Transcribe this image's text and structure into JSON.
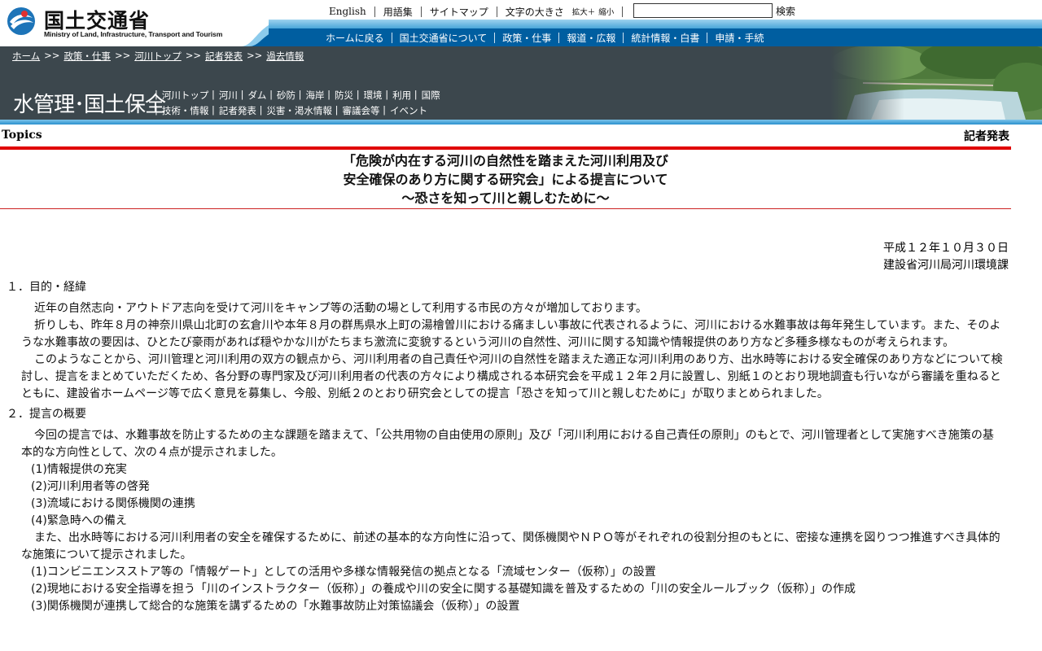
{
  "header": {
    "logo_jp": "国土交通省",
    "logo_en": "Ministry of Land, Infrastructure, Transport and Tourism",
    "util_links": [
      "English",
      "用語集",
      "サイトマップ"
    ],
    "font_size_label": "文字の大きさ",
    "font_enlarge": "拡大＋",
    "font_shrink": "縮小",
    "search_value": "",
    "search_button": "検索",
    "nav": [
      "ホームに戻る",
      "国土交通省について",
      "政策・仕事",
      "報道・広報",
      "統計情報・白書",
      "申請・手続"
    ]
  },
  "band": {
    "breadcrumb": [
      "ホーム",
      "政策・仕事",
      "河川トップ",
      "記者発表",
      "過去情報"
    ],
    "breadcrumb_sep": ">>",
    "section_title": "水管理･国土保全",
    "subnav_row1": [
      "河川トップ",
      "河川",
      "ダム",
      "砂防",
      "海岸",
      "防災",
      "環境",
      "利用",
      "国際"
    ],
    "subnav_row2": [
      "技術・情報",
      "記者発表",
      "災害・渇水情報",
      "審議会等",
      "イベント"
    ]
  },
  "topics": {
    "label": "Topics",
    "right": "記者発表"
  },
  "document": {
    "title_lines": [
      "「危険が内在する河川の自然性を踏まえた河川利用及び",
      "安全確保のあり方に関する研究会」による提言について",
      "～恐さを知って川と親しむために～"
    ],
    "date": "平成１２年１０月３０日",
    "org": "建設省河川局河川環境課",
    "sec1_heading": "１．目的・経緯",
    "sec1_paragraphs": [
      "近年の自然志向・アウトドア志向を受けて河川をキャンプ等の活動の場として利用する市民の方々が増加しております。",
      "折りしも、昨年８月の神奈川県山北町の玄倉川や本年８月の群馬県水上町の湯檜曽川における痛ましい事故に代表されるように、河川における水難事故は毎年発生しています。また、そのような水難事故の要因は、ひとたび豪雨があれば穏やかな川がたちまち激流に変貌するという河川の自然性、河川に関する知識や情報提供のあり方など多種多様なものが考えられます。",
      "このようなことから、河川管理と河川利用の双方の観点から、河川利用者の自己責任や河川の自然性を踏まえた適正な河川利用のあり方、出水時等における安全確保のあり方などについて検討し、提言をまとめていただくため、各分野の専門家及び河川利用者の代表の方々により構成される本研究会を平成１２年２月に設置し、別紙１のとおり現地調査も行いながら審議を重ねるとともに、建設省ホームページ等で広く意見を募集し、今般、別紙２のとおり研究会としての提言「恐さを知って川と親しむために」が取りまとめられました。"
    ],
    "sec2_heading": "２．提言の概要",
    "sec2_intro": "今回の提言では、水難事故を防止するための主な課題を踏まえて、「公共用物の自由使用の原則」及び「河川利用における自己責任の原則」のもとで、河川管理者として実施すべき施策の基本的な方向性として、次の４点が提示されました。",
    "sec2_points": [
      "(1)情報提供の充実",
      "(2)河川利用者等の啓発",
      "(3)流域における関係機関の連携",
      "(4)緊急時への備え"
    ],
    "sec2_para2": "また、出水時等における河川利用者の安全を確保するために、前述の基本的な方向性に沿って、関係機関やＮＰＯ等がそれぞれの役割分担のもとに、密接な連携を図りつつ推進すべき具体的な施策について提示されました。",
    "sec2_measures": [
      "(1)コンビニエンスストア等の「情報ゲート」としての活用や多様な情報発信の拠点となる「流域センター（仮称）」の設置",
      "(2)現地における安全指導を担う「川のインストラクター（仮称）」の養成や川の安全に関する基礎知識を普及するための「川の安全ルールブック（仮称）」の作成",
      "(3)関係機関が連携して総合的な施策を講ずるための「水難事故防止対策協議会（仮称）」の設置"
    ]
  }
}
